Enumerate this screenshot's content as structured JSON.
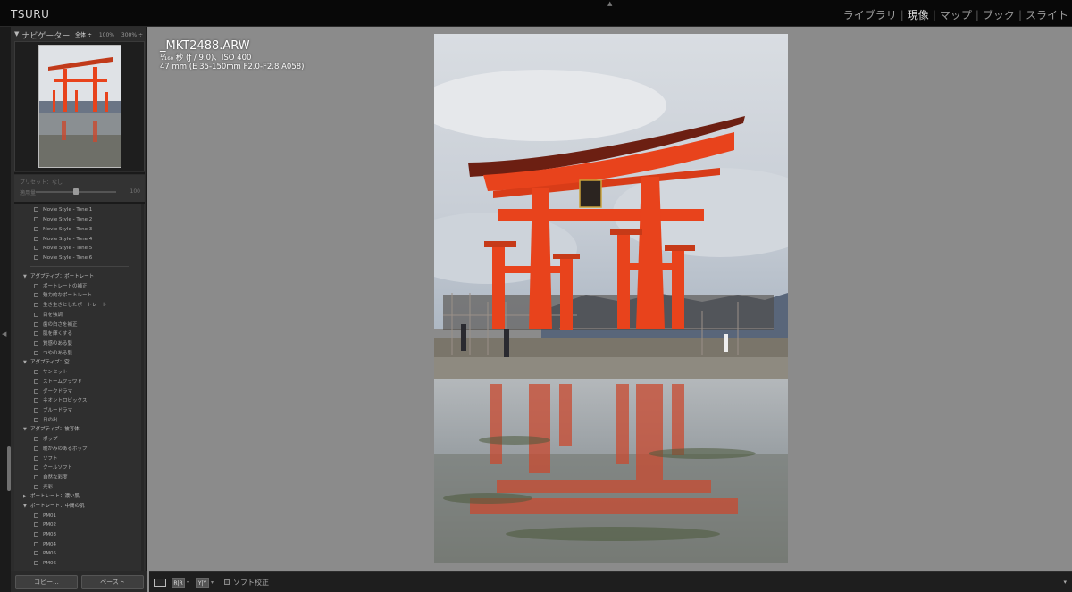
{
  "app": {
    "brand": "TSURU"
  },
  "modules": [
    {
      "label": "ライブラリ",
      "active": false
    },
    {
      "label": "現像",
      "active": true
    },
    {
      "label": "マップ",
      "active": false
    },
    {
      "label": "ブック",
      "active": false
    },
    {
      "label": "スライト",
      "active": false
    }
  ],
  "navigator": {
    "title": "ナビゲーター",
    "zoom": {
      "fit": "全体 ÷",
      "z100": "100%",
      "z300": "300% ÷"
    }
  },
  "preset_amount": {
    "preset_label": "プリセット：なし",
    "amount_label": "適用量",
    "amount_value": "100",
    "level": 0.5
  },
  "preset_list": {
    "movie": [
      "Movie Style - Tone 1",
      "Movie Style - Tone 2",
      "Movie Style - Tone 3",
      "Movie Style - Tone 4",
      "Movie Style - Tone 5",
      "Movie Style - Tone 6"
    ],
    "group_portrait": "アダプティブ：ポートレート",
    "portrait": [
      "ポートレートの補正",
      "魅力的なポートレート",
      "生き生きとしたポートレート",
      "目を強調",
      "歯の白さを補正",
      "肌を輝くする",
      "質感のある髪",
      "つやのある髪"
    ],
    "group_sky": "アダプティブ：空",
    "sky": [
      "サンセット",
      "ストームクラウド",
      "ダークドラマ",
      "ネオントロピックス",
      "ブルードラマ",
      "日の出"
    ],
    "group_subject": "アダプティブ：被写体",
    "subject": [
      "ポップ",
      "暖かみのあるポップ",
      "ソフト",
      "クールソフト",
      "自然な彩度",
      "光彩"
    ],
    "group_dark_skin": "ポートレート：濃い肌",
    "group_medium_skin": "ポートレート：中間の肌",
    "medium": [
      "PM01",
      "PM02",
      "PM03",
      "PM04",
      "PM05",
      "PM06"
    ]
  },
  "buttons": {
    "copy": "コピー...",
    "paste": "ペースト"
  },
  "image_info": {
    "filename": "_MKT2488.ARW",
    "exposure": "¹⁄₁₆₀ 秒 (ƒ / 9.0)、ISO 400",
    "lens": "47 mm (E 35-150mm F2.0-F2.8 A058)"
  },
  "toolbar": {
    "compare_label": "R|R",
    "yy_label": "Y|Y",
    "soft_proof_label": "ソフト校正"
  },
  "colors": {
    "accent_torii": "#e8431c",
    "panel": "#2c2c2c",
    "topbar": "#080808"
  }
}
